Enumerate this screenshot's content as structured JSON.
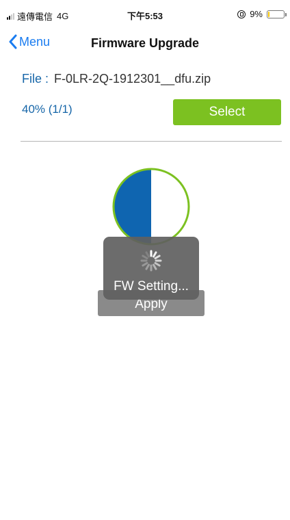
{
  "status_bar": {
    "carrier": "遠傳電信",
    "network": "4G",
    "time": "下午5:53",
    "battery_text": "9%",
    "battery_level": 0.09,
    "battery_color": "#f5c400"
  },
  "nav": {
    "back_label": "Menu",
    "title": "Firmware Upgrade"
  },
  "file": {
    "label": "File :",
    "name": "F-0LR-2Q-1912301__dfu.zip"
  },
  "progress": {
    "text": "40% (1/1)",
    "fraction": 0.5
  },
  "buttons": {
    "select_label": "Select",
    "apply_label": "Apply"
  },
  "hud": {
    "message": "FW Setting..."
  },
  "colors": {
    "accent_blue": "#1a7cf0",
    "label_blue": "#1565a8",
    "select_green": "#7cc121",
    "pie_fill": "#0f65b0",
    "ring_green": "#7cc121"
  }
}
